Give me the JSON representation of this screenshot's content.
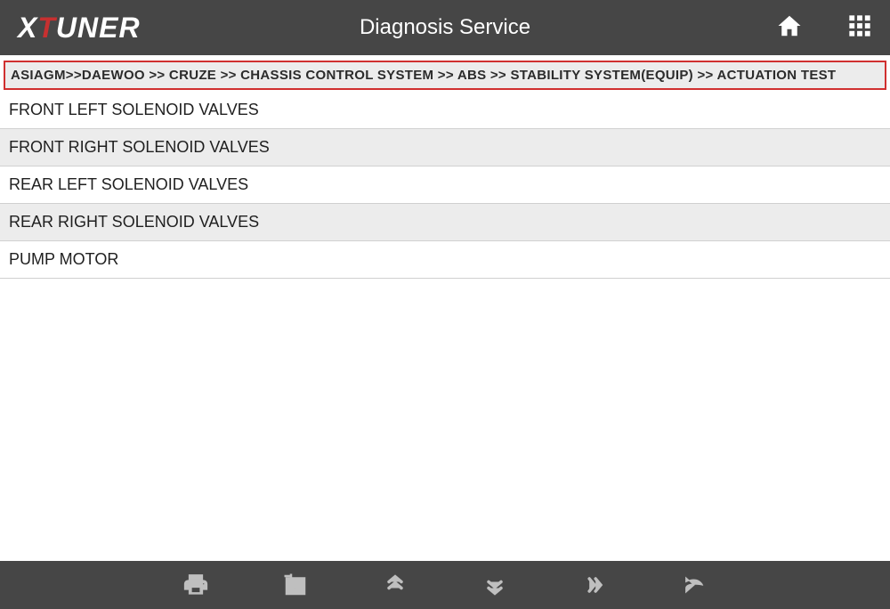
{
  "header": {
    "logo_x": "X",
    "logo_t": "T",
    "logo_rest": "UNER",
    "title": "Diagnosis Service"
  },
  "breadcrumb": "ASIAGM>>DAEWOO >> CRUZE >> CHASSIS CONTROL SYSTEM >> ABS >> STABILITY SYSTEM(EQUIP) >> ACTUATION TEST",
  "items": [
    "FRONT LEFT SOLENOID VALVES",
    "FRONT RIGHT SOLENOID VALVES",
    "REAR LEFT SOLENOID VALVES",
    "REAR RIGHT SOLENOID VALVES",
    "PUMP MOTOR"
  ]
}
